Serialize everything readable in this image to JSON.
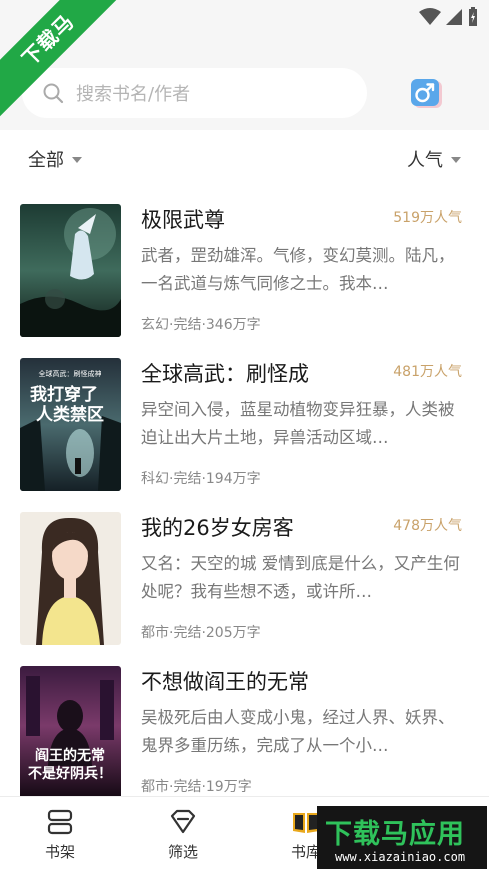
{
  "watermark": {
    "ribbon_text": "下载马",
    "brand_text": "下载马应用",
    "brand_url": "www.xiazainiao.com"
  },
  "search": {
    "placeholder": "搜索书名/作者"
  },
  "filters": {
    "category": "全部",
    "sort": "人气"
  },
  "books": [
    {
      "title": "极限武尊",
      "popularity": "519万人气",
      "desc": "武者，罡劲雄浑。气修，变幻莫测。陆凡，一名武道与炼气同修之士。我本…",
      "meta": "玄幻·完结·346万字"
    },
    {
      "title": "全球高武：刷怪成",
      "popularity": "481万人气",
      "desc": "异空间入侵，蓝星动植物变异狂暴，人类被迫让出大片土地，异兽活动区域…",
      "meta": "科幻·完结·194万字",
      "cover_text": [
        "全球高武：刷怪成神",
        "我打穿了",
        "人类禁区"
      ]
    },
    {
      "title": "我的26岁女房客",
      "popularity": "478万人气",
      "desc": "又名：天空的城 爱情到底是什么，又产生何处呢？我有些想不透，或许所…",
      "meta": "都市·完结·205万字"
    },
    {
      "title": "不想做阎王的无常",
      "popularity": "",
      "desc": "吴极死后由人变成小鬼，经过人界、妖界、鬼界多重历练，完成了从一个小…",
      "meta": "都市·完结·19万字",
      "cover_text": [
        "阎王的无常",
        "不是好阴兵！"
      ]
    }
  ],
  "nav": {
    "shelf": "书架",
    "filter": "筛选",
    "library": "书库"
  },
  "colors": {
    "accent": "#c9a26a",
    "ribbon": "#21a846",
    "gender": "#5aa7ea"
  }
}
